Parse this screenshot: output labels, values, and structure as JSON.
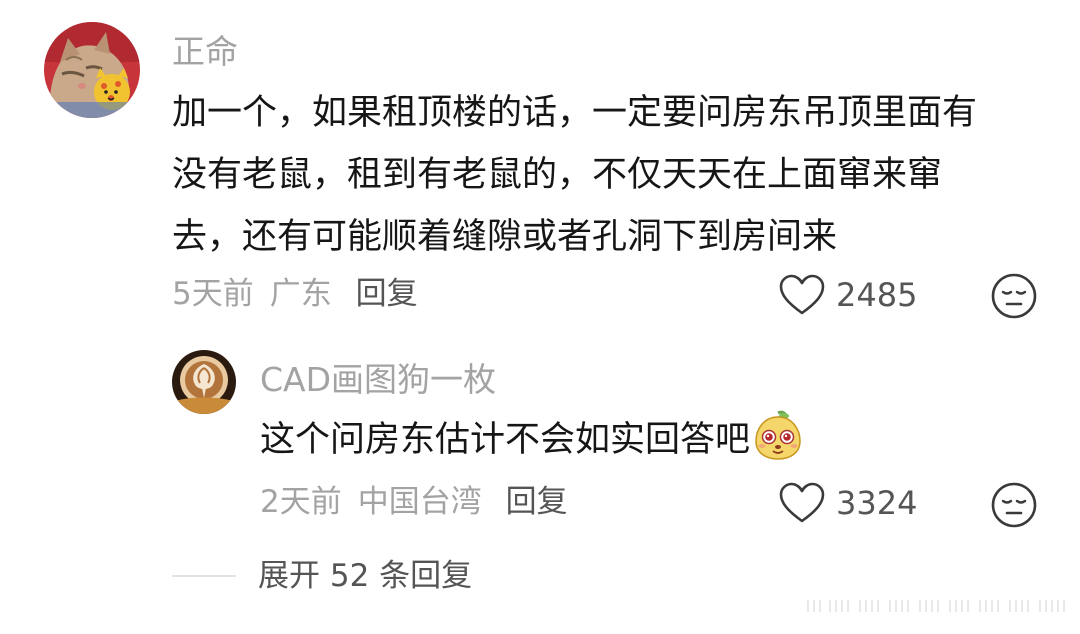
{
  "comment": {
    "username": "正命",
    "lines": [
      "加一个，如果租顶楼的话，一定要问房东吊顶里面有",
      "没有老鼠，租到有老鼠的，不仅天天在上面窜来窜",
      "去，还有可能顺着缝隙或者孔洞下到房间来"
    ],
    "time": "5天前",
    "location": "广东",
    "reply_label": "回复",
    "like_count": "2485",
    "avatar_icon": "cat-avatar-icon",
    "like_icon": "heart-outline-icon",
    "dislike_icon": "neutral-face-icon"
  },
  "reply": {
    "username": "CAD画图狗一枚",
    "text": "这个问房东估计不会如实回答吧",
    "sticker_icon": "cute-face-sticker-icon",
    "time": "2天前",
    "location": "中国台湾",
    "reply_label": "回复",
    "like_count": "3324",
    "avatar_icon": "latte-art-avatar-icon",
    "like_icon": "heart-outline-icon",
    "dislike_icon": "neutral-face-icon"
  },
  "expand_label": "展开 52 条回复",
  "colors": {
    "username": "#a3a3a3",
    "text": "#161616",
    "meta": "#a3a3a3",
    "action": "#555555",
    "background": "#ffffff"
  }
}
